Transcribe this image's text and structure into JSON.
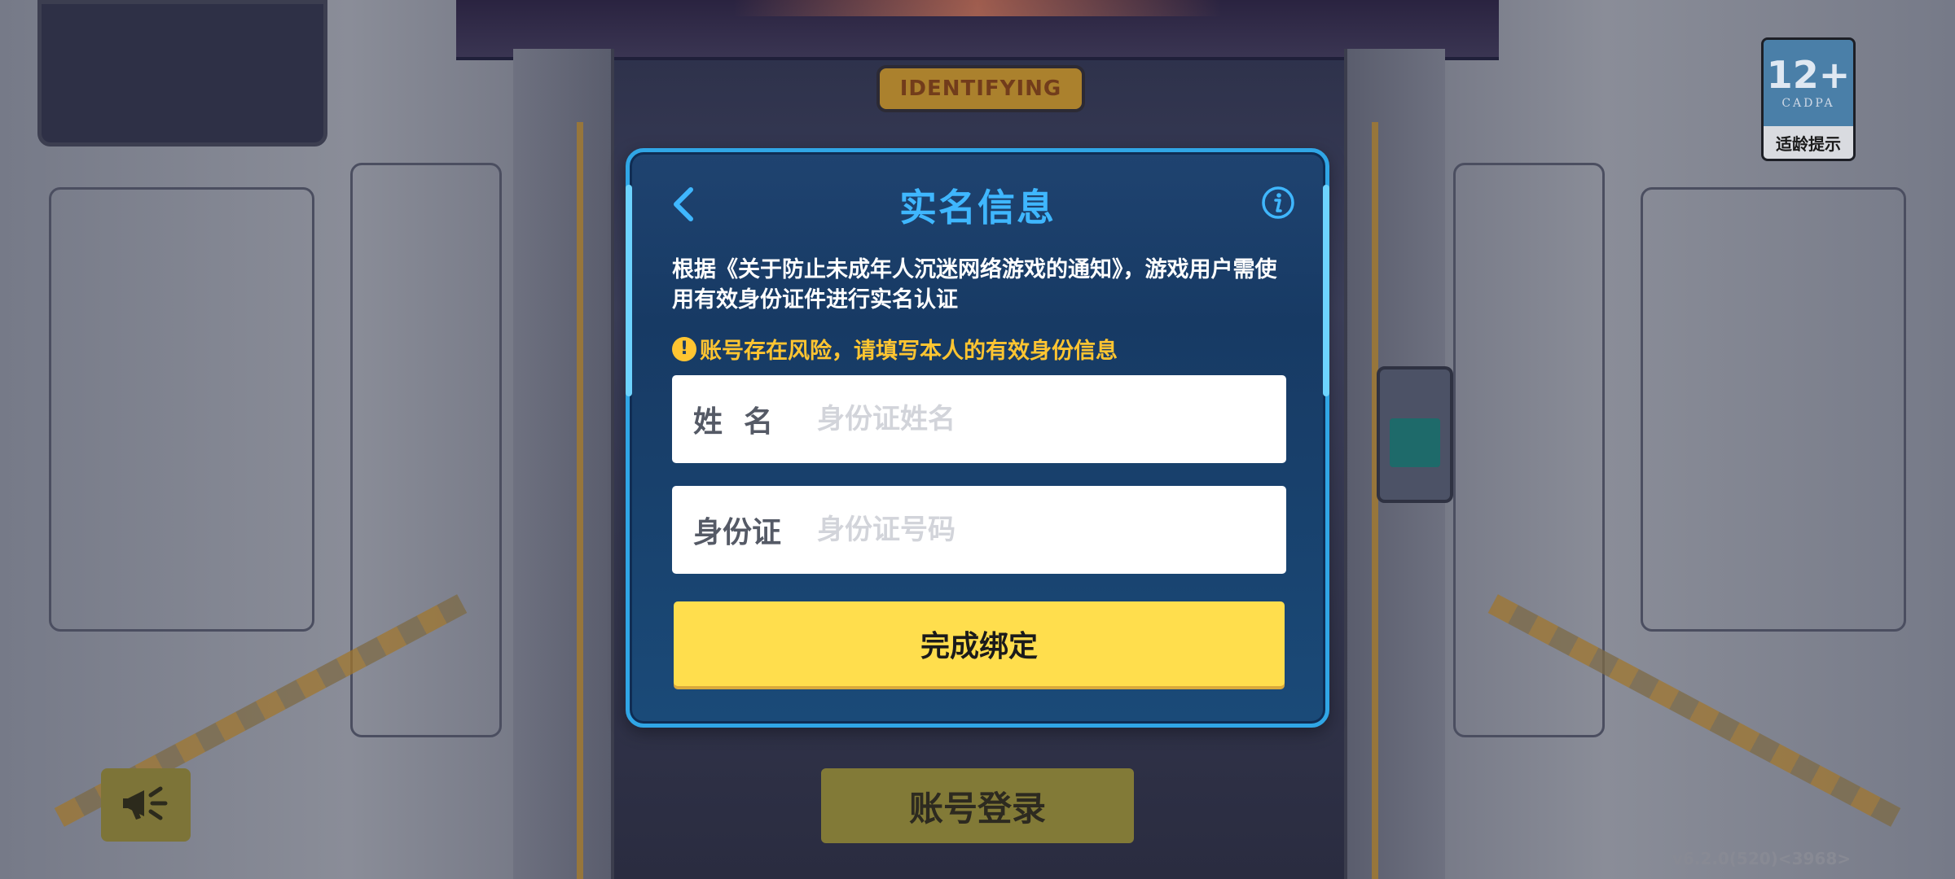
{
  "background": {
    "sign_text": "IDENTIFYING",
    "age_badge": {
      "age": "12+",
      "org": "CADPA",
      "tip": "适龄提示"
    },
    "sound_icon": "megaphone-icon",
    "login_button_label": "账号登录",
    "version": "v6.2.0(520)<3968>"
  },
  "modal": {
    "title": "实名信息",
    "back_icon": "chevron-left-icon",
    "info_icon": "info-icon",
    "notice": "根据《关于防止未成年人沉迷网络游戏的通知》，游戏用户需使用有效身份证件进行实名认证",
    "warning_icon_glyph": "!",
    "warning": "账号存在风险，请填写本人的有效身份信息",
    "name_field": {
      "label": "姓名",
      "placeholder": "身份证姓名",
      "value": ""
    },
    "id_field": {
      "label": "身份证",
      "placeholder": "身份证号码",
      "value": ""
    },
    "submit_label": "完成绑定"
  },
  "colors": {
    "title": "#3fb7ff",
    "warning": "#ffc531",
    "button": "#ffde4d",
    "modal_border": "#30a6e6"
  }
}
